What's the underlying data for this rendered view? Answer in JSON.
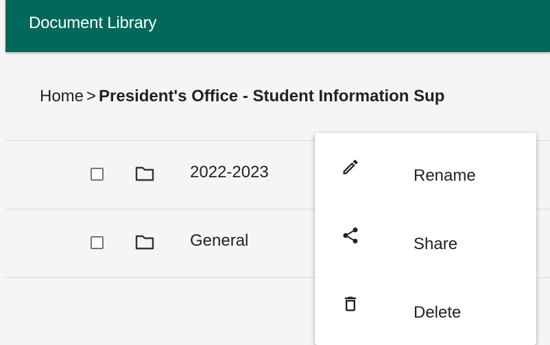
{
  "appbar": {
    "title": "Document Library",
    "color": "#00695c"
  },
  "breadcrumb": {
    "home": "Home",
    "separator": ">",
    "current": "President's Office - Student Information Sup"
  },
  "list": {
    "items": [
      {
        "label": "2022-2023",
        "icon": "folder-icon",
        "checked": false
      },
      {
        "label": "General",
        "icon": "folder-icon",
        "checked": false
      }
    ]
  },
  "context_menu": {
    "items": [
      {
        "label": "Rename",
        "icon": "pencil-icon"
      },
      {
        "label": "Share",
        "icon": "share-icon"
      },
      {
        "label": "Delete",
        "icon": "trash-icon"
      }
    ]
  }
}
